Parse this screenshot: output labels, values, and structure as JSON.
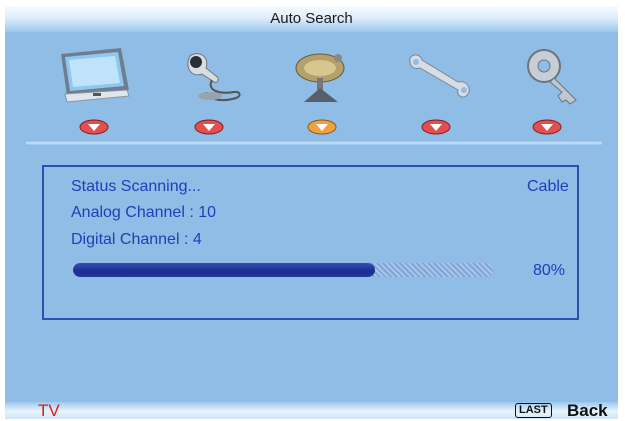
{
  "menu": {
    "title": "Auto Search",
    "icons": [
      {
        "name": "picture-menu-icon",
        "selected": false
      },
      {
        "name": "audio-menu-icon",
        "selected": false
      },
      {
        "name": "channel-menu-icon",
        "selected": true
      },
      {
        "name": "setup-menu-icon",
        "selected": false
      },
      {
        "name": "lock-menu-icon",
        "selected": false
      }
    ]
  },
  "status": {
    "scanning_label": "Status Scanning...",
    "source": "Cable",
    "analog_label": "Analog Channel : 10",
    "digital_label": "Digital Channel : 4",
    "progress_percent": 80,
    "progress_text": "80%"
  },
  "footer": {
    "input_label": "TV",
    "last_key": "LAST",
    "back_label": "Back"
  },
  "colors": {
    "accent_text": "#1f3fb8",
    "selected_marker": "#f0a040",
    "unselected_marker": "#e05050"
  }
}
